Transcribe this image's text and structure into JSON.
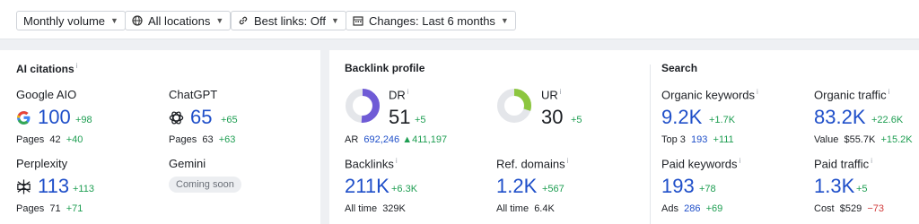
{
  "toolbar": {
    "volume": "Monthly volume",
    "locations": "All locations",
    "best_links": "Best links: Off",
    "changes": "Changes: Last 6 months"
  },
  "ai_citations": {
    "title": "AI citations",
    "info": "i",
    "google_aio": {
      "label": "Google AIO",
      "value": "100",
      "delta": "+98",
      "pages_label": "Pages",
      "pages_value": "42",
      "pages_delta": "+40"
    },
    "chatgpt": {
      "label": "ChatGPT",
      "value": "65",
      "delta": "+65",
      "pages_label": "Pages",
      "pages_value": "63",
      "pages_delta": "+63"
    },
    "perplexity": {
      "label": "Perplexity",
      "value": "113",
      "delta": "+113",
      "pages_label": "Pages",
      "pages_value": "71",
      "pages_delta": "+71"
    },
    "gemini": {
      "label": "Gemini",
      "badge": "Coming soon"
    }
  },
  "backlink_profile": {
    "title": "Backlink profile",
    "dr": {
      "label": "DR",
      "info": "i",
      "value": "51",
      "delta": "+5",
      "ring_fraction": 0.51,
      "ring_color": "#6f5bd6"
    },
    "ur": {
      "label": "UR",
      "info": "i",
      "value": "30",
      "delta": "+5",
      "ring_fraction": 0.3,
      "ring_color": "#8cc63f"
    },
    "ar": {
      "label": "AR",
      "value": "692,246",
      "delta": "411,197"
    },
    "backlinks": {
      "label": "Backlinks",
      "info": "i",
      "value": "211K",
      "delta": "+6.3K",
      "sub_label": "All time",
      "sub_value": "329K"
    },
    "ref_domains": {
      "label": "Ref. domains",
      "info": "i",
      "value": "1.2K",
      "delta": "+567",
      "sub_label": "All time",
      "sub_value": "6.4K"
    }
  },
  "search": {
    "title": "Search",
    "organic_keywords": {
      "label": "Organic keywords",
      "info": "i",
      "value": "9.2K",
      "delta": "+1.7K",
      "sub_label": "Top 3",
      "sub_value": "193",
      "sub_delta": "+111"
    },
    "organic_traffic": {
      "label": "Organic traffic",
      "info": "i",
      "value": "83.2K",
      "delta": "+22.6K",
      "sub_label": "Value",
      "sub_value": "$55.7K",
      "sub_delta": "+15.2K"
    },
    "paid_keywords": {
      "label": "Paid keywords",
      "info": "i",
      "value": "193",
      "delta": "+78",
      "sub_label": "Ads",
      "sub_value": "286",
      "sub_delta": "+69"
    },
    "paid_traffic": {
      "label": "Paid traffic",
      "info": "i",
      "value": "1.3K",
      "delta": "+5",
      "sub_label": "Cost",
      "sub_value": "$529",
      "sub_delta": "−73"
    }
  },
  "colors": {
    "accent_blue": "#1f4fc9",
    "positive": "#1e9e52",
    "negative": "#d03a3a"
  }
}
